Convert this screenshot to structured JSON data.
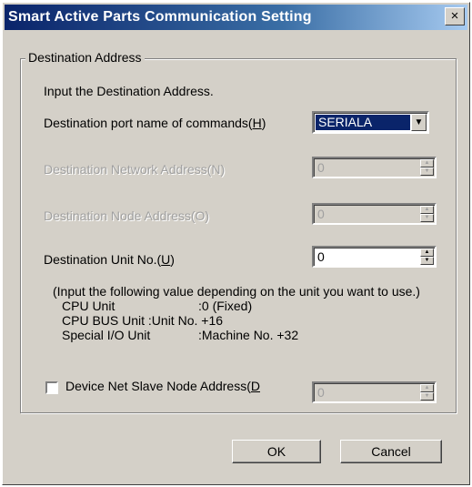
{
  "window": {
    "title": "Smart Active Parts Communication Setting",
    "close_glyph": "×"
  },
  "group": {
    "legend": "Destination Address"
  },
  "instruction": "Input the Destination Address.",
  "port": {
    "label_pre": "Destination port name of commands(",
    "label_key": "H",
    "label_post": ")",
    "value": "SERIALA"
  },
  "network": {
    "label": "Destination Network Address(N)",
    "value": "0"
  },
  "node": {
    "label": "Destination Node Address(O)",
    "value": "0"
  },
  "unit": {
    "label_pre": "Destination Unit No.(",
    "label_key": "U",
    "label_post": ")",
    "value": "0"
  },
  "info": {
    "line1": "(Input the following value depending on the unit you want to use.)",
    "cpu_unit_name": "CPU Unit",
    "cpu_unit_value": ":0 (Fixed)",
    "cpu_bus_line": "CPU BUS Unit :Unit No. +16",
    "special_name": "Special I/O Unit",
    "special_value": ":Machine No. +32"
  },
  "devicenet": {
    "label_pre": "Device Net Slave Node Address(",
    "label_key": "D",
    "value": "0",
    "checked": false
  },
  "buttons": {
    "ok": "OK",
    "cancel": "Cancel"
  },
  "icons": {
    "spin": "spin-up-down-icon",
    "dropdown": "chevron-down-icon",
    "close": "close-icon"
  },
  "colors": {
    "titlebar_start": "#0a246a",
    "titlebar_end": "#a6caf0",
    "face": "#d4d0c8",
    "selection": "#0a246a"
  }
}
